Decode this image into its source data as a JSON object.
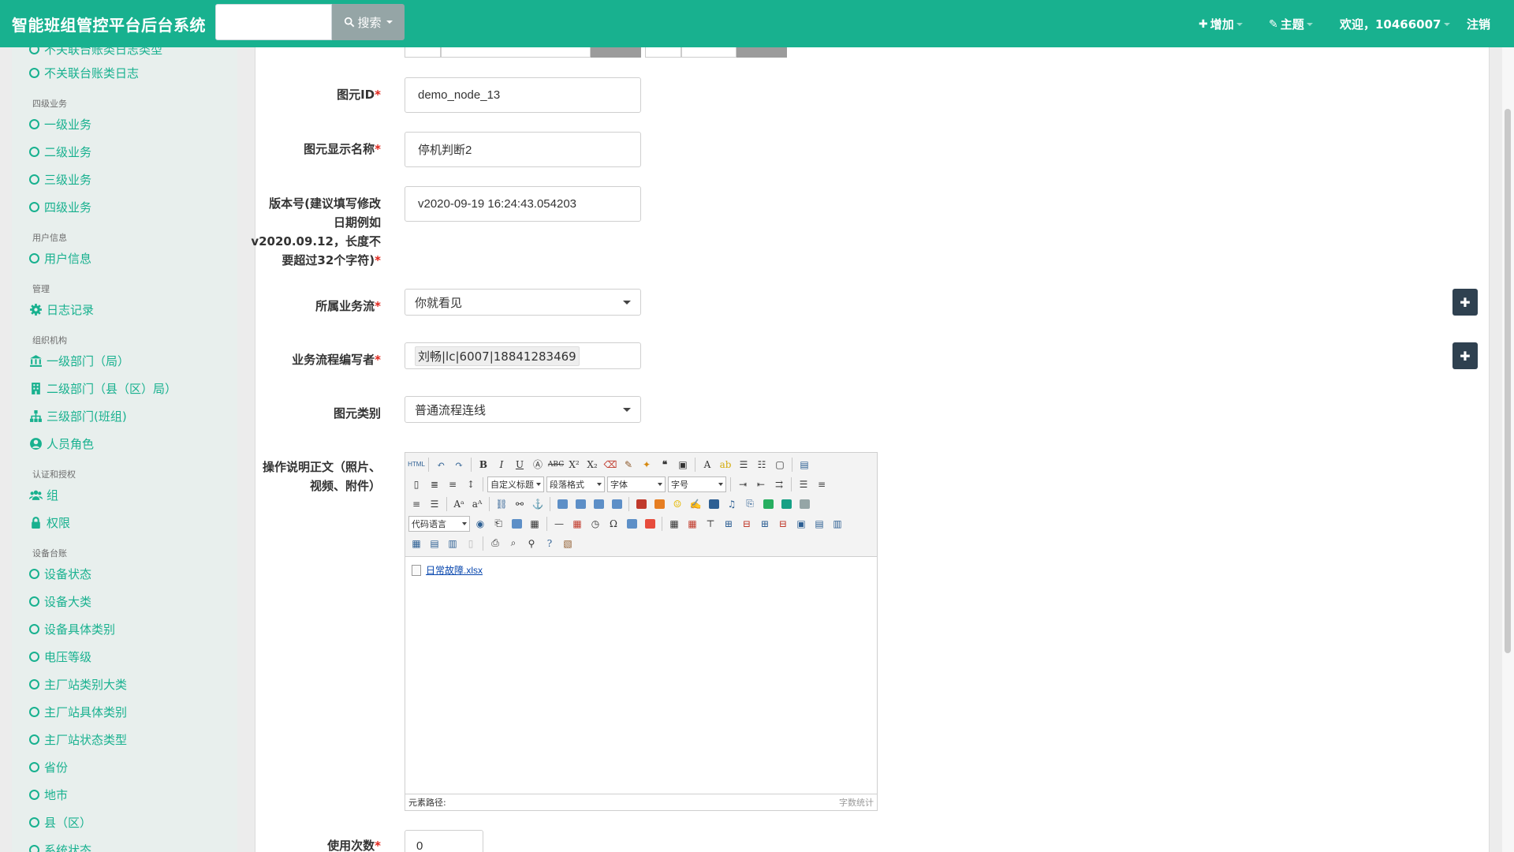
{
  "navbar": {
    "brand": "智能班组管控平台后台系统",
    "search_value": "",
    "search_label": "搜索",
    "add_label": "增加",
    "theme_label": "主题",
    "welcome_label": "欢迎，10466007",
    "logout_label": "注销"
  },
  "sidebar": {
    "cut_item": "不关联台账类日志类型",
    "items": [
      {
        "label": "不关联台账类日志",
        "icon": "circle-o-icon"
      },
      {
        "header": "四级业务"
      },
      {
        "label": "一级业务",
        "icon": "circle-o-icon"
      },
      {
        "label": "二级业务",
        "icon": "circle-o-icon"
      },
      {
        "label": "三级业务",
        "icon": "circle-o-icon"
      },
      {
        "label": "四级业务",
        "icon": "circle-o-icon"
      },
      {
        "header": "用户信息"
      },
      {
        "label": "用户信息",
        "icon": "circle-o-icon"
      },
      {
        "header": "管理"
      },
      {
        "label": "日志记录",
        "icon": "gear-icon"
      },
      {
        "header": "组织机构"
      },
      {
        "label": "一级部门（局）",
        "icon": "bank-icon"
      },
      {
        "label": "二级部门（县（区）局）",
        "icon": "building-icon"
      },
      {
        "label": "三级部门(班组)",
        "icon": "sitemap-icon"
      },
      {
        "label": "人员角色",
        "icon": "user-circle-icon"
      },
      {
        "header": "认证和授权"
      },
      {
        "label": "组",
        "icon": "users-icon"
      },
      {
        "label": "权限",
        "icon": "lock-icon"
      },
      {
        "header": "设备台账"
      },
      {
        "label": "设备状态",
        "icon": "circle-o-icon"
      },
      {
        "label": "设备大类",
        "icon": "circle-o-icon"
      },
      {
        "label": "设备具体类别",
        "icon": "circle-o-icon"
      },
      {
        "label": "电压等级",
        "icon": "circle-o-icon"
      },
      {
        "label": "主厂站类别大类",
        "icon": "circle-o-icon"
      },
      {
        "label": "主厂站具体类别",
        "icon": "circle-o-icon"
      },
      {
        "label": "主厂站状态类型",
        "icon": "circle-o-icon"
      },
      {
        "label": "省份",
        "icon": "circle-o-icon"
      },
      {
        "label": "地市",
        "icon": "circle-o-icon"
      },
      {
        "label": "县（区）",
        "icon": "circle-o-icon"
      },
      {
        "label": "系统状态",
        "icon": "circle-o-icon"
      }
    ]
  },
  "form": {
    "node_id": {
      "label": "图元ID",
      "value": "demo_node_13"
    },
    "display_name": {
      "label": "图元显示名称",
      "value": "停机判断2"
    },
    "version": {
      "label_lines": [
        "版本号(建议填写修改",
        "日期例如",
        "v2020.09.12，长度不",
        "要超过32个字符)"
      ],
      "value": "v2020-09-19 16:24:43.054203"
    },
    "flow": {
      "label": "所属业务流",
      "value": "你就看见"
    },
    "author": {
      "label": "业务流程编写者",
      "value": "刘畅|lc|6007|18841283469"
    },
    "node_type": {
      "label": "图元类别",
      "value": "普通流程连线"
    },
    "desc": {
      "label_lines": [
        "操作说明正文（照片、",
        "视频、附件）"
      ]
    },
    "use_count": {
      "label": "使用次数",
      "value": "0"
    }
  },
  "editor": {
    "combo_custom_title": "自定义标题",
    "combo_paragraph": "段落格式",
    "combo_font": "字体",
    "combo_size": "字号",
    "combo_code_lang": "代码语言",
    "html_btn": "HTML",
    "attachment": "日常故障.xlsx",
    "path_label": "元素路径:",
    "word_count_label": "字数统计"
  },
  "colors": {
    "brand": "#18b18f",
    "dark_button": "#2f4150",
    "required": "#e0241a"
  }
}
